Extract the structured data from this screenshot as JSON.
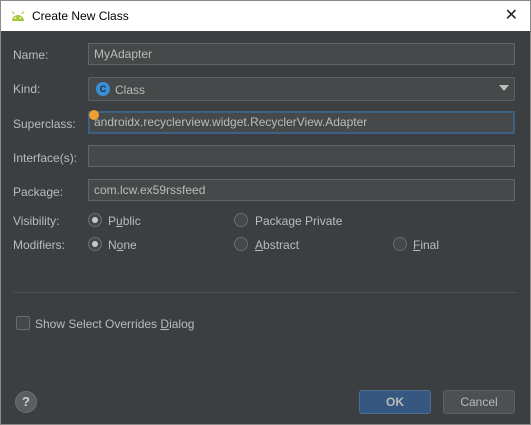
{
  "window": {
    "title": "Create New Class",
    "close_glyph": "✕"
  },
  "form": {
    "name_label": "Name:",
    "name_value": "MyAdapter",
    "kind_label": "Kind:",
    "kind_value": "Class",
    "kind_icon_letter": "C",
    "superclass_label": "Superclass:",
    "superclass_value": "androidx.recyclerview.widget.RecyclerView.Adapter",
    "interfaces_label": "Interface(s):",
    "interfaces_value": "",
    "package_label": "Package:",
    "package_value": "com.lcw.ex59rssfeed"
  },
  "visibility": {
    "label": "Visibility:",
    "public": {
      "pre": "P",
      "u": "u",
      "post": "blic",
      "checked": true
    },
    "package_private": {
      "text": "Package Private",
      "checked": false
    }
  },
  "modifiers": {
    "label": "Modifiers:",
    "none": {
      "pre": "N",
      "u": "o",
      "post": "ne",
      "checked": true
    },
    "abstract": {
      "pre": "",
      "u": "A",
      "post": "bstract",
      "checked": false
    },
    "final": {
      "pre": "",
      "u": "F",
      "post": "inal",
      "checked": false
    }
  },
  "overrides": {
    "pre": "Show Select Overrides ",
    "u": "D",
    "post": "ialog",
    "checked": false
  },
  "buttons": {
    "help": "?",
    "ok": "OK",
    "cancel": "Cancel"
  },
  "colors": {
    "background": "#3c3f41",
    "field": "#45494a",
    "focus_border": "#3d6185",
    "ok_button": "#365880",
    "android_green": "#a4c639",
    "class_icon": "#3a8fd6"
  },
  "icons": {
    "app": "android-icon",
    "kind": "class-icon",
    "dropdown": "chevron-down-icon",
    "help": "help-icon",
    "close": "close-icon"
  }
}
